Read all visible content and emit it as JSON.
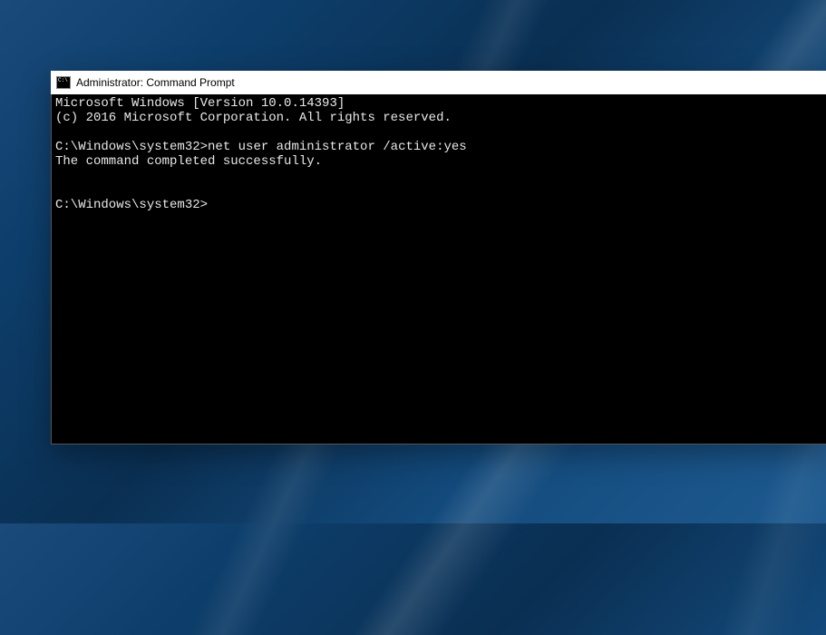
{
  "window": {
    "title": "Administrator: Command Prompt"
  },
  "terminal": {
    "banner_line1": "Microsoft Windows [Version 10.0.14393]",
    "banner_line2": "(c) 2016 Microsoft Corporation. All rights reserved.",
    "session": {
      "prompt1": "C:\\Windows\\system32>",
      "command1": "net user administrator /active:yes",
      "output1": "The command completed successfully.",
      "prompt2": "C:\\Windows\\system32>"
    }
  }
}
